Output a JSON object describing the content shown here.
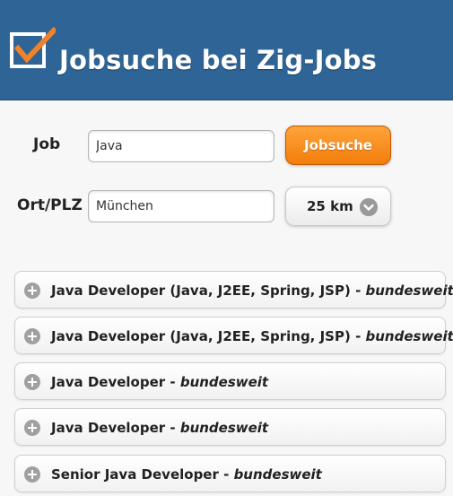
{
  "header": {
    "title": "Jobsuche bei Zig-Jobs",
    "logo_icon": "checkbox-check-icon",
    "background": "#2e6496",
    "accent": "#f0822a"
  },
  "form": {
    "job_label": "Job",
    "job_value": "Java",
    "location_label": "Ort/PLZ",
    "location_value": "München",
    "search_button_label": "Jobsuche",
    "search_button_color": "#f27d0c",
    "radius_value": "25 km",
    "radius_icon": "chevron-down-icon"
  },
  "results": [
    {
      "title": "Java Developer (Java, J2EE, Spring, JSP)",
      "separator": " - ",
      "location": "bundesweit"
    },
    {
      "title": "Java Developer (Java, J2EE, Spring, JSP)",
      "separator": " - ",
      "location": "bundesweit"
    },
    {
      "title": "Java Developer",
      "separator": " - ",
      "location": "bundesweit"
    },
    {
      "title": "Java Developer",
      "separator": " - ",
      "location": "bundesweit"
    },
    {
      "title": "Senior Java Developer",
      "separator": " - ",
      "location": "bundesweit"
    }
  ]
}
